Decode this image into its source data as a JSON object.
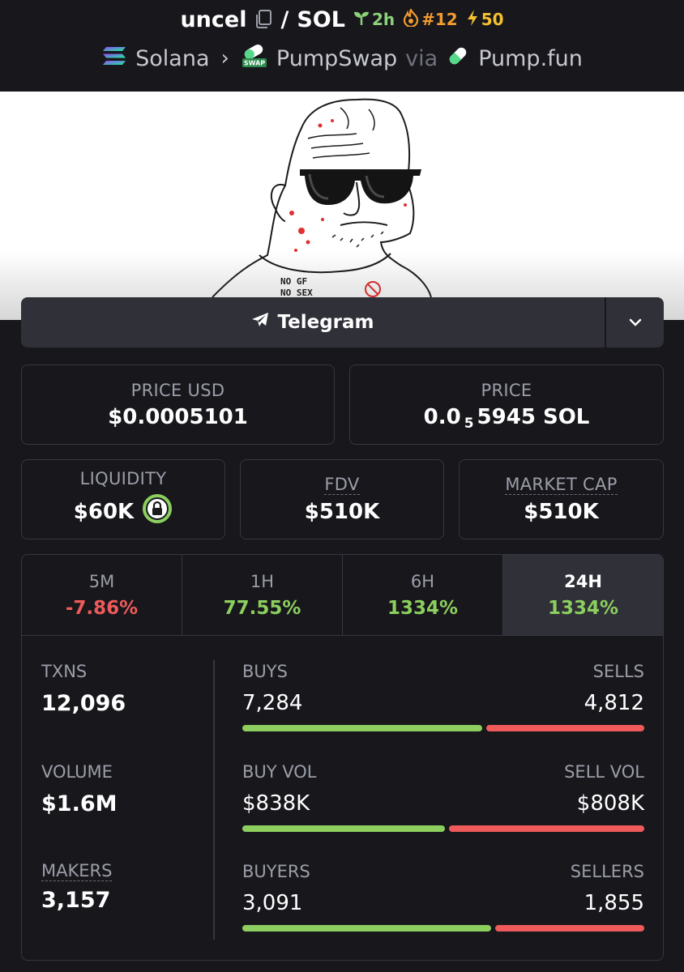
{
  "header": {
    "token": "uncel",
    "slash": "/",
    "quote": "SOL",
    "age": "2h",
    "trend_rank": "#12",
    "boosts": "50",
    "chain": "Solana",
    "dex": "PumpSwap",
    "via": "via",
    "launchpad": "Pump.fun"
  },
  "banner": {
    "shirt_line1": "NO GF",
    "shirt_line2": "NO SEX"
  },
  "socials": {
    "telegram_label": "Telegram"
  },
  "prices": {
    "usd_label": "PRICE USD",
    "usd_value": "$0.0005101",
    "native_label": "PRICE",
    "native_prefix": "0.0",
    "native_zeros": "5",
    "native_suffix": "5945 SOL"
  },
  "metrics": {
    "liquidity_label": "LIQUIDITY",
    "liquidity_value": "$60K",
    "fdv_label": "FDV",
    "fdv_value": "$510K",
    "mcap_label": "MARKET CAP",
    "mcap_value": "$510K"
  },
  "periods": [
    {
      "label": "5M",
      "change": "-7.86%",
      "direction": "down",
      "active": false
    },
    {
      "label": "1H",
      "change": "77.55%",
      "direction": "up",
      "active": false
    },
    {
      "label": "6H",
      "change": "1334%",
      "direction": "up",
      "active": false
    },
    {
      "label": "24H",
      "change": "1334%",
      "direction": "up",
      "active": true
    }
  ],
  "stats": {
    "txns_label": "TXNS",
    "txns_value": "12,096",
    "volume_label": "VOLUME",
    "volume_value": "$1.6M",
    "makers_label": "MAKERS",
    "makers_value": "3,157",
    "buys_label": "BUYS",
    "buys_value": "7,284",
    "sells_label": "SELLS",
    "sells_value": "4,812",
    "buys_share": 0.602,
    "buy_vol_label": "BUY VOL",
    "buy_vol_value": "$838K",
    "sell_vol_label": "SELL VOL",
    "sell_vol_value": "$808K",
    "buy_vol_share": 0.509,
    "buyers_label": "BUYERS",
    "buyers_value": "3,091",
    "sellers_label": "SELLERS",
    "sellers_value": "1,855",
    "buyers_share": 0.625
  },
  "colors": {
    "background": "#17171c",
    "card_border": "#363740",
    "positive": "#8ccf5e",
    "negative": "#ef5a5a",
    "age_badge": "#8cd17a",
    "trend_badge": "#f29b2f",
    "boost_badge": "#f5c12e"
  }
}
